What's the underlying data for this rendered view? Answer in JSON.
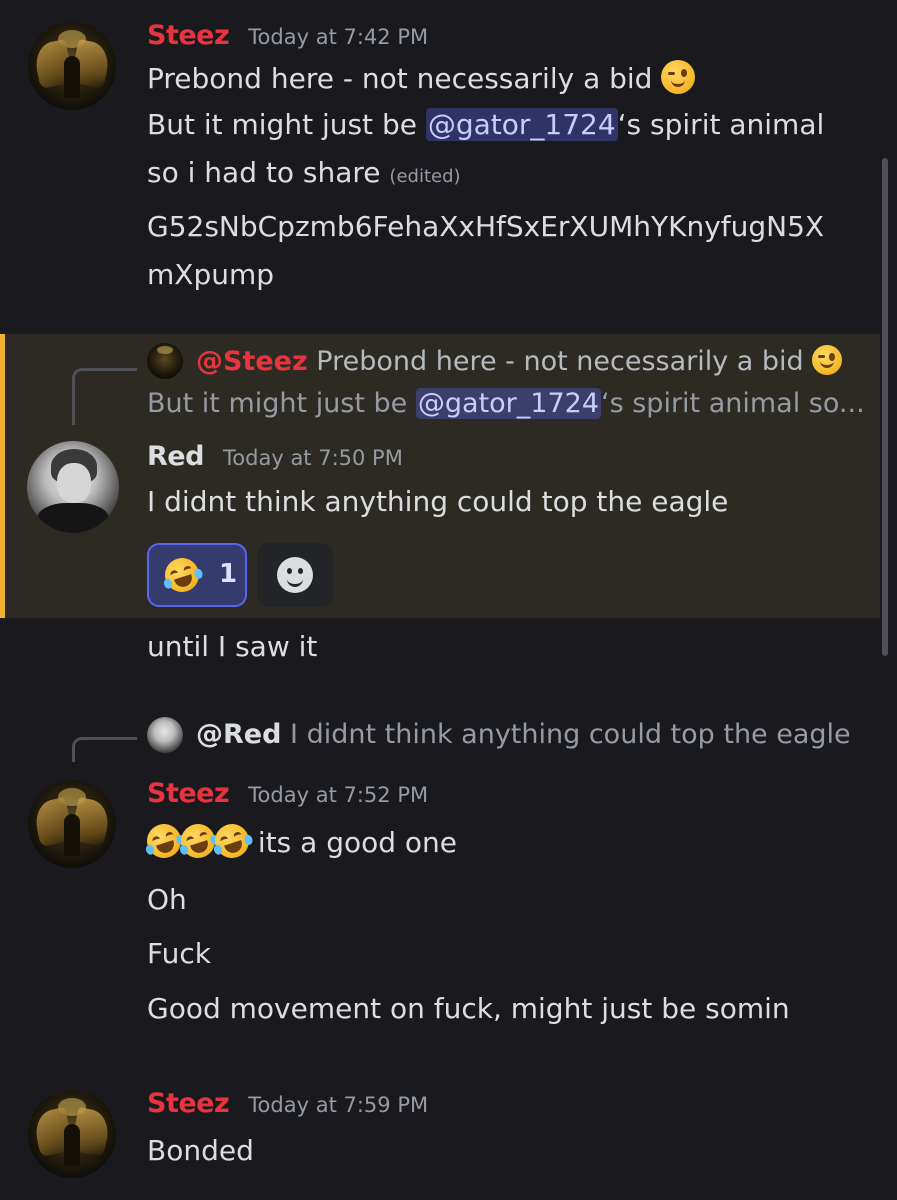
{
  "messages": {
    "m1": {
      "author": "Steez",
      "timestamp": "Today at 7:42 PM",
      "line1": "Prebond here - not necessarily a bid",
      "line2_pre": "But it might just be",
      "mention": "@gator_1724",
      "line2_post": "‘s spirit animal",
      "line3": "so i had to share",
      "edited": "(edited)",
      "ca_line1": "G52sNbCpzmb6FehaXxHfSxErXUMhYKnyfugN5X",
      "ca_line2": "mXpump"
    },
    "m2": {
      "reply_author": "@Steez",
      "reply_line1": "Prebond here - not necessarily a bid",
      "reply_line2_pre": "But it might just be",
      "reply_mention": "@gator_1724",
      "reply_line2_post": "‘s spirit animal so...",
      "author": "Red",
      "timestamp": "Today at 7:50 PM",
      "text": "I didnt think anything could top the eagle",
      "reaction_count": "1",
      "followup": "until I saw it"
    },
    "m3": {
      "reply_author": "@Red",
      "reply_text": "I didnt think anything could top the eagle",
      "author": "Steez",
      "timestamp": "Today at 7:52 PM",
      "text1": "its a good one",
      "text2": "Oh",
      "text3": "Fuck",
      "text4": "Good movement on fuck, might just be somin"
    },
    "m4": {
      "author": "Steez",
      "timestamp": "Today at 7:59 PM",
      "text1": "Bonded"
    }
  },
  "colors": {
    "steez_name": "#e8343e",
    "red_name": "#dbdee1",
    "mention_bg": "#3c4270",
    "highlight_bar": "#f0b232"
  },
  "icons": [
    "wink-emoji",
    "rofl-emoji",
    "add-reaction-icon",
    "avatar-steez",
    "avatar-red"
  ]
}
